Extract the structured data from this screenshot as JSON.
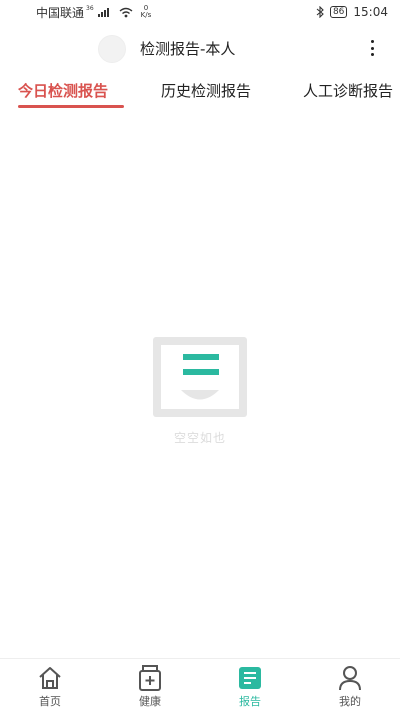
{
  "status_bar": {
    "carrier": "中国联通",
    "signal_tag": "36",
    "net_speed_value": "0",
    "net_speed_unit": "K/s",
    "battery": "86",
    "time": "15:04"
  },
  "header": {
    "title": "检测报告-本人"
  },
  "tabs": [
    {
      "label": "今日检测报告",
      "active": true
    },
    {
      "label": "历史检测报告",
      "active": false
    },
    {
      "label": "人工诊断报告",
      "active": false
    }
  ],
  "empty_state": {
    "text": "空空如也"
  },
  "bottom_nav": [
    {
      "label": "首页",
      "icon": "home-icon",
      "active": false
    },
    {
      "label": "健康",
      "icon": "medicine-icon",
      "active": false
    },
    {
      "label": "报告",
      "icon": "report-icon",
      "active": true
    },
    {
      "label": "我的",
      "icon": "person-icon",
      "active": false
    }
  ],
  "colors": {
    "accent_red": "#d9534f",
    "accent_teal": "#2bb9a0",
    "empty_gray": "#dcdcdc"
  }
}
